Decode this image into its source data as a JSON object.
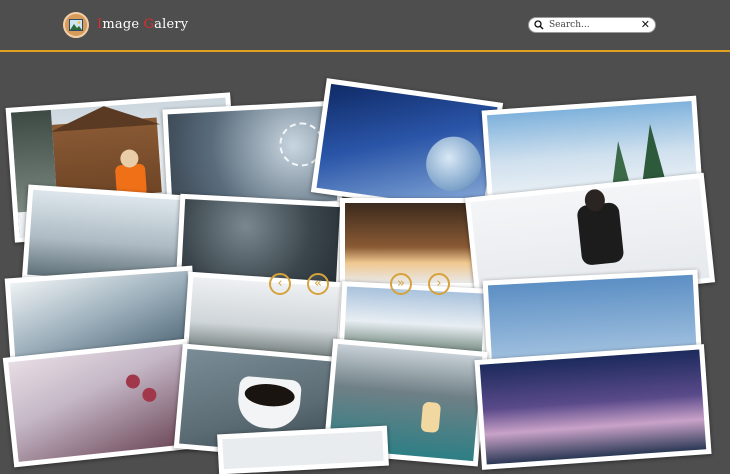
{
  "header": {
    "brand_first_initial": "I",
    "brand_first_rest": "mage ",
    "brand_second_initial": "G",
    "brand_second_rest": "alery",
    "logo_icon": "image-icon"
  },
  "search": {
    "placeholder": "Search...",
    "value": "",
    "clear_label": "✕",
    "icon": "search-icon"
  },
  "navigation": {
    "prev_label": "‹",
    "first_label": "«",
    "last_label": "»",
    "next_label": "›"
  },
  "colors": {
    "background": "#4e4e4e",
    "header_rule": "#e0a020",
    "nav_accent": "#d6a23a",
    "brand_accent": "#e32b2b"
  },
  "photos": [
    {
      "name": "log-cabin-woman-orange-jacket"
    },
    {
      "name": "snowflake-closeup"
    },
    {
      "name": "frozen-bubble"
    },
    {
      "name": "frosted-trees-blue-sky"
    },
    {
      "name": "snowy-forest-hillside"
    },
    {
      "name": "falling-snow-dark"
    },
    {
      "name": "forest-road-sunset"
    },
    {
      "name": "woman-black-jacket-snow"
    },
    {
      "name": "misty-mountains"
    },
    {
      "name": "foggy-pine-hills"
    },
    {
      "name": "snowy-pines-village"
    },
    {
      "name": "snowflakes-blue-sky"
    },
    {
      "name": "frozen-berries"
    },
    {
      "name": "coffee-cup-knit"
    },
    {
      "name": "woman-lake-mountains"
    },
    {
      "name": "milky-way-mountains"
    }
  ]
}
